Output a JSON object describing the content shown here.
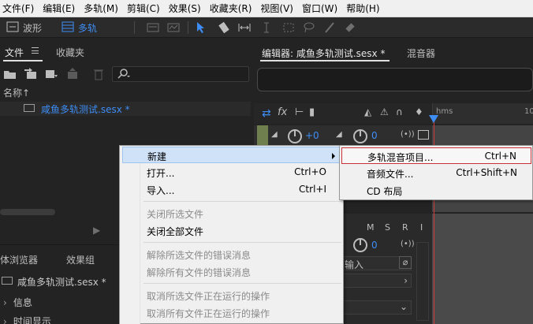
{
  "menubar": {
    "items": [
      "文件(F)",
      "编辑(E)",
      "多轨(M)",
      "剪辑(C)",
      "效果(S)",
      "收藏夹(R)",
      "视图(V)",
      "窗口(W)",
      "帮助(H)"
    ]
  },
  "toolbar": {
    "waveform_label": "波形",
    "multitrack_label": "多轨"
  },
  "files_panel": {
    "tab_files": "文件",
    "tab_favorites": "收藏夹",
    "search_placeholder": "",
    "column_name": "名称",
    "sort_indicator": "↑",
    "file_name": "咸鱼多轨测试.sesx *"
  },
  "browser_panel": {
    "tab_media": "体浏览器",
    "tab_effects": "效果组",
    "file_name": "咸鱼多轨测试.sesx *",
    "section_info": "信息",
    "section_time": "时间显示"
  },
  "editor": {
    "tab_editor": "编辑器: 咸鱼多轨测试.sesx *",
    "tab_mixer": "混音器",
    "ruler_label_start": "hms",
    "ruler_label_end": "10",
    "track1": {
      "vol": "+0",
      "pan": "0"
    },
    "track2": {
      "m": "M",
      "s": "S",
      "r": "R",
      "i": "I",
      "pan": "0",
      "input": "输入"
    }
  },
  "context_menu": {
    "items": [
      {
        "label": "新建",
        "shortcut": "",
        "disabled": false,
        "submenu": true
      },
      {
        "label": "打开...",
        "shortcut": "Ctrl+O",
        "disabled": false
      },
      {
        "label": "导入...",
        "shortcut": "Ctrl+I",
        "disabled": false
      },
      {
        "label": "关闭所选文件",
        "shortcut": "",
        "disabled": true
      },
      {
        "label": "关闭全部文件",
        "shortcut": "",
        "disabled": false
      },
      {
        "label": "解除所选文件的错误消息",
        "shortcut": "",
        "disabled": true
      },
      {
        "label": "解除所有文件的错误消息",
        "shortcut": "",
        "disabled": true
      },
      {
        "label": "取消所选文件正在运行的操作",
        "shortcut": "",
        "disabled": true
      },
      {
        "label": "取消所有文件正在运行的操作",
        "shortcut": "",
        "disabled": true
      }
    ]
  },
  "submenu": {
    "items": [
      {
        "label": "多轨混音项目...",
        "shortcut": "Ctrl+N"
      },
      {
        "label": "音频文件...",
        "shortcut": "Ctrl+Shift+N"
      },
      {
        "label": "CD 布局",
        "shortcut": ""
      }
    ]
  },
  "colors": {
    "accent": "#3d8df5",
    "playhead": "#d23a3a",
    "submenu_highlight": "#c8303a"
  }
}
